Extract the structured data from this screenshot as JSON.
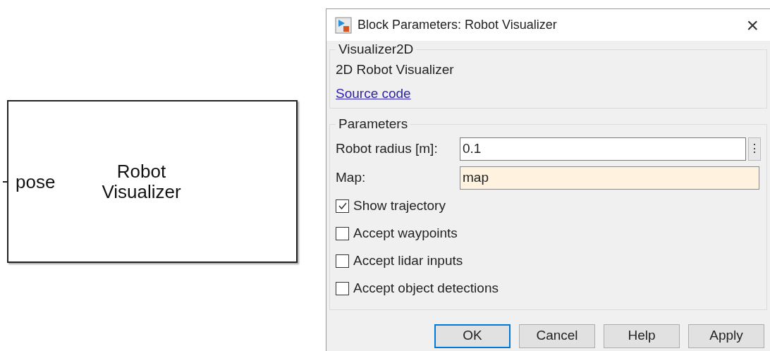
{
  "block": {
    "title": "Robot\nVisualizer",
    "port": "pose"
  },
  "dialog": {
    "title": "Block Parameters: Robot Visualizer",
    "close": "×",
    "description_group": {
      "legend": "Visualizer2D",
      "text": "2D Robot Visualizer",
      "link": "Source code"
    },
    "parameters": {
      "legend": "Parameters",
      "fields": [
        {
          "label": "Robot radius [m]:",
          "value": "0.1",
          "kind": "edit",
          "menu": "⋮"
        },
        {
          "label": "Map:",
          "value": "map",
          "kind": "highlighted"
        }
      ],
      "options": [
        {
          "label": "Show trajectory",
          "checked": true
        },
        {
          "label": "Accept waypoints",
          "checked": false
        },
        {
          "label": "Accept lidar inputs",
          "checked": false
        },
        {
          "label": "Accept object detections",
          "checked": false
        }
      ]
    },
    "buttons": [
      {
        "label": "OK",
        "selected": true
      },
      {
        "label": "Cancel",
        "selected": false
      },
      {
        "label": "Help",
        "selected": false
      },
      {
        "label": "Apply",
        "selected": false
      }
    ]
  }
}
